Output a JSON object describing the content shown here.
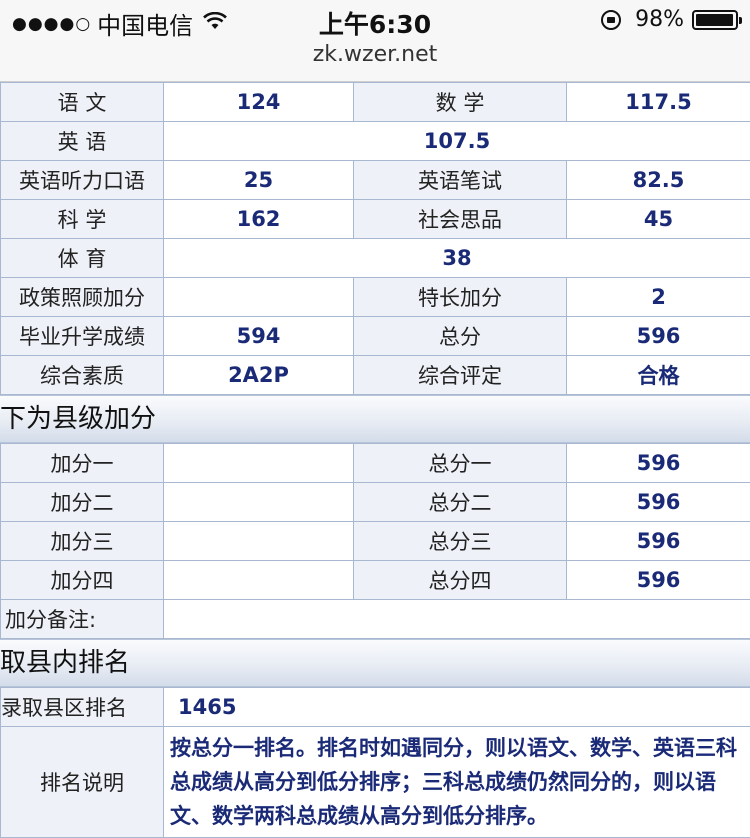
{
  "status_bar": {
    "carrier": "中国电信",
    "time": "上午6:30",
    "battery": "98%",
    "battery_level": 0.98
  },
  "browser": {
    "url": "zk.wzer.net"
  },
  "scores": {
    "rows": [
      [
        "语 文",
        "124",
        "数 学",
        "117.5"
      ],
      [
        "英 语",
        "107.5"
      ],
      [
        "英语听力口语",
        "25",
        "英语笔试",
        "82.5"
      ],
      [
        "科 学",
        "162",
        "社会思品",
        "45"
      ],
      [
        "体 育",
        "38"
      ],
      [
        "政策照顾加分",
        "",
        "特长加分",
        "2"
      ],
      [
        "毕业升学成绩",
        "594",
        "总分",
        "596"
      ],
      [
        "综合素质",
        "2A2P",
        "综合评定",
        "合格"
      ]
    ]
  },
  "county_bonus": {
    "title": "以下为县级加分",
    "rows": [
      [
        "加分一",
        "",
        "总分一",
        "596"
      ],
      [
        "加分二",
        "",
        "总分二",
        "596"
      ],
      [
        "加分三",
        "",
        "总分三",
        "596"
      ],
      [
        "加分四",
        "",
        "总分四",
        "596"
      ]
    ],
    "note_label": "加分备注:",
    "note_value": ""
  },
  "ranking": {
    "title": "录取县内排名",
    "rank_label": "录取县区排名",
    "rank_value": "1465",
    "explain_label": "排名说明",
    "explain_text": "按总分一排名。排名时如遇同分，则以语文、数学、英语三科总成绩从高分到低分排序；三科总成绩仍然同分的，则以语文、数学两科总成绩从高分到低分排序。"
  }
}
